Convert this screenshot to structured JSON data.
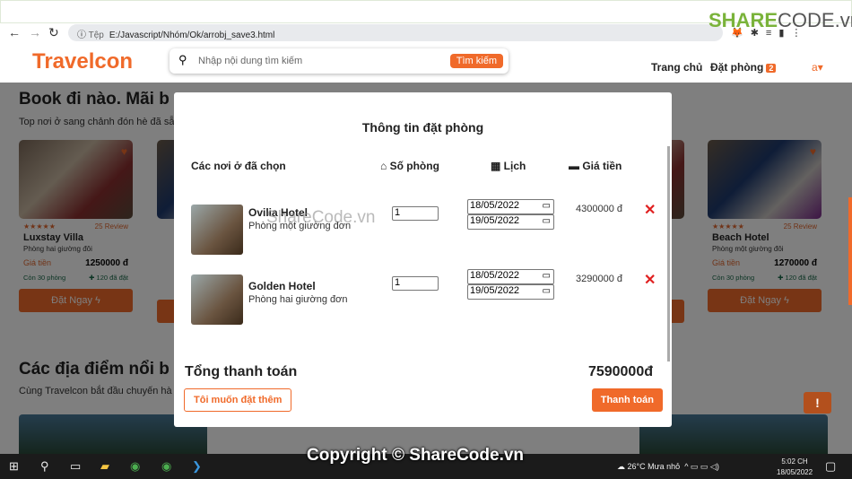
{
  "browser": {
    "url_prefix": "Tệp",
    "url": "E:/Javascript/Nhóm/Ok/arrobj_save3.html"
  },
  "header": {
    "logo": "Travelcon",
    "search_placeholder": "Nhập nội dung tìm kiếm",
    "search_button": "Tìm kiếm",
    "nav_home": "Trang chủ",
    "nav_booking": "Đặt phòng",
    "booking_count": "2",
    "user": "a"
  },
  "section1": {
    "title": "Book đi nào. Mãi b",
    "subtitle": "Top nơi ở sang chảnh đón hè đã sẵ"
  },
  "cards": [
    {
      "rating_stars": 5,
      "stars": "★★★★★",
      "reviews": "25 Review",
      "name": "Luxstay Villa",
      "room_type": "Phòng hai giường đôi",
      "price_label": "Giá tiền",
      "price": "1250000 đ",
      "rooms_left": "Còn 30 phòng",
      "booked": "120 đã đặt",
      "button": "Đặt Ngay"
    },
    {
      "rating_stars": 5,
      "stars": "★★★★★",
      "reviews": "25 Review",
      "name": "Beach Hotel",
      "room_type": "Phòng một giường đôi",
      "price_label": "Giá tiền",
      "price": "1270000 đ",
      "rooms_left": "Còn 30 phòng",
      "booked": "120 đã đặt",
      "button": "Đặt Ngay"
    }
  ],
  "section2": {
    "title": "Các địa điểm nổi b",
    "subtitle": "Cùng Travelcon bắt đầu chuyến hà"
  },
  "modal": {
    "title": "Thông tin đặt phòng",
    "columns": {
      "places": "Các nơi ở đã chọn",
      "rooms": "Số phòng",
      "calendar": "Lịch",
      "price": "Giá tiền"
    },
    "items": [
      {
        "name": "Ovilia Hotel",
        "room_type": "Phòng một giường đơn",
        "quantity": "1",
        "check_in": "18/05/2022",
        "check_out": "19/05/2022",
        "price": "4300000 đ"
      },
      {
        "name": "Golden Hotel",
        "room_type": "Phòng hai giường đơn",
        "quantity": "1",
        "check_in": "18/05/2022",
        "check_out": "19/05/2022",
        "price": "3290000 đ"
      }
    ],
    "total_label": "Tổng thanh toán",
    "total": "7590000đ",
    "add_more": "Tôi muốn đặt thêm",
    "pay": "Thanh toán"
  },
  "taskbar": {
    "temperature": "26°C",
    "weather": "Mưa nhỏ",
    "time": "5:02 CH",
    "date": "18/05/2022"
  },
  "watermark": {
    "text": "Copyright © ShareCode.vn",
    "overlay": "ShareCode.vn",
    "logo": "SHARECODE.vn"
  },
  "colors": {
    "accent": "#f06a2a",
    "delete": "#e02020"
  }
}
